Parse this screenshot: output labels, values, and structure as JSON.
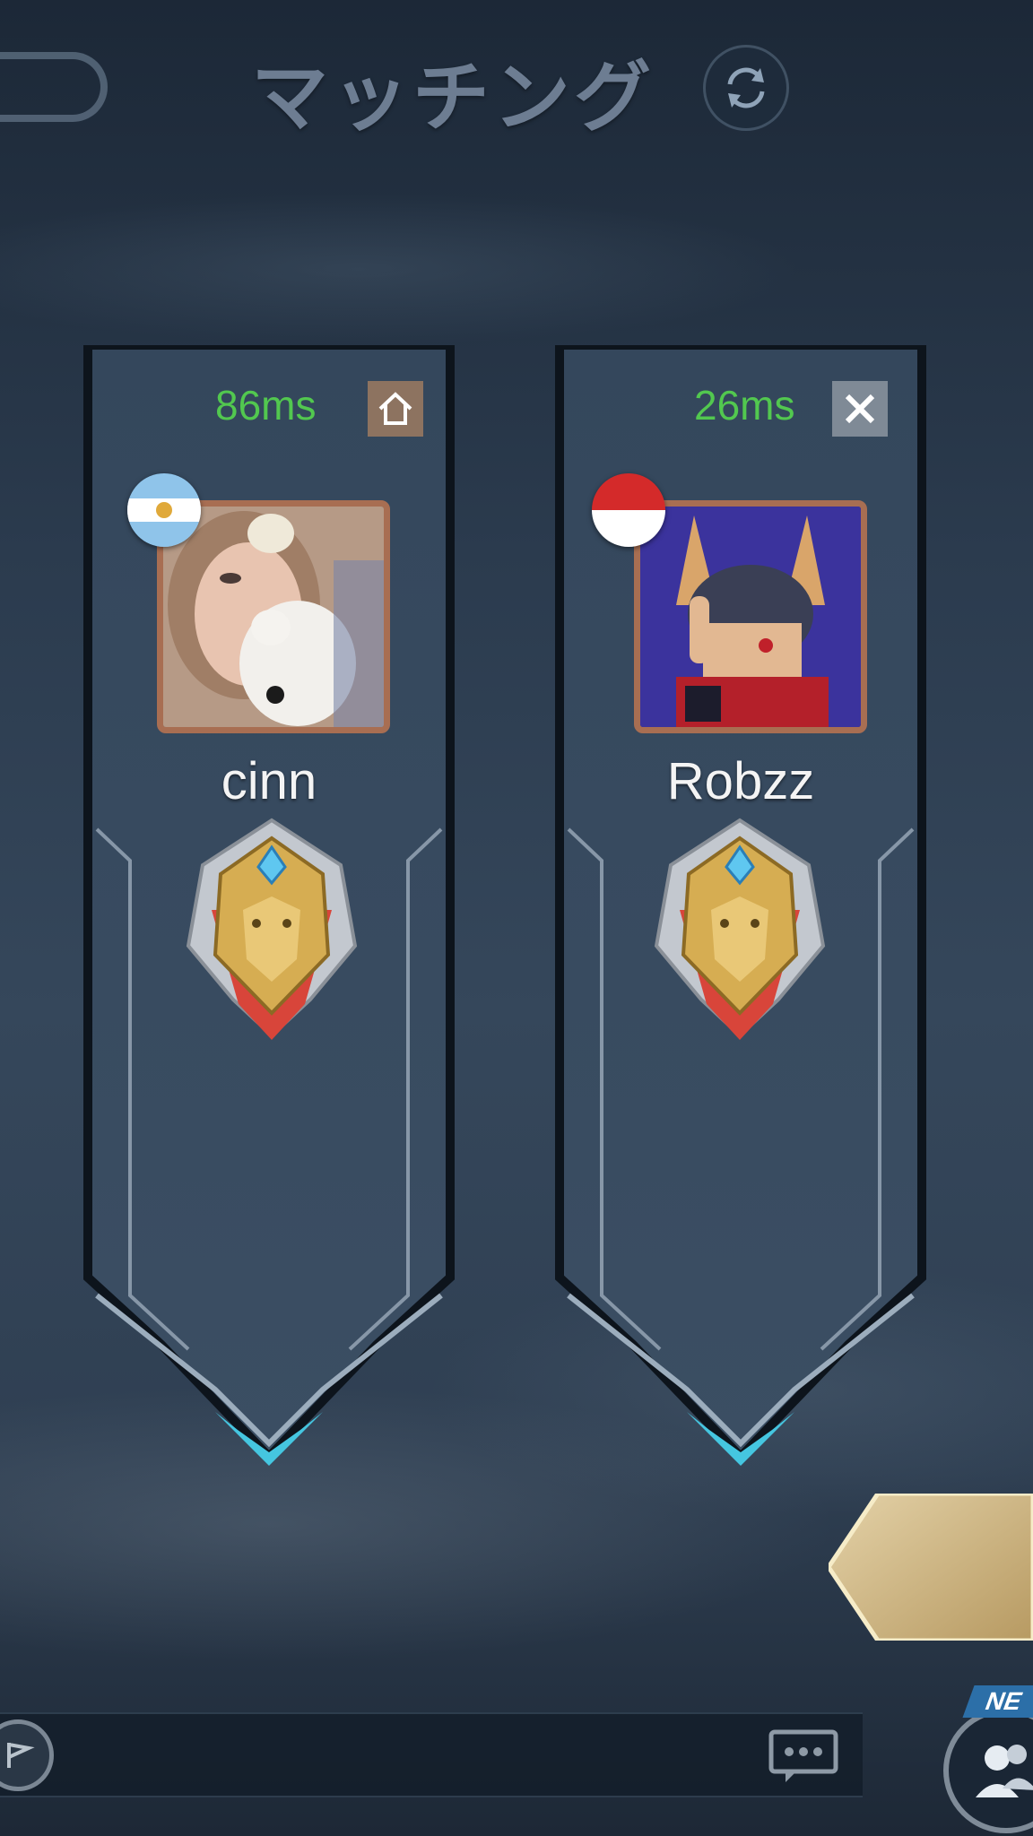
{
  "header": {
    "title": "マッチング"
  },
  "players": [
    {
      "name": "cinn",
      "ping": "86ms",
      "status_icon": "home-icon",
      "flag": "argentina-flag",
      "avatar": "girl-with-plush-avatar"
    },
    {
      "name": "Robzz",
      "ping": "26ms",
      "status_icon": "close-icon",
      "flag": "indonesia-flag",
      "avatar": "horned-ninja-hero-avatar"
    }
  ],
  "badges": {
    "new": "NE"
  },
  "colors": {
    "ping": "#52c84f",
    "title": "#6d7d92",
    "accent_cyan": "#45c6e0",
    "gold": "#d6ad52"
  }
}
